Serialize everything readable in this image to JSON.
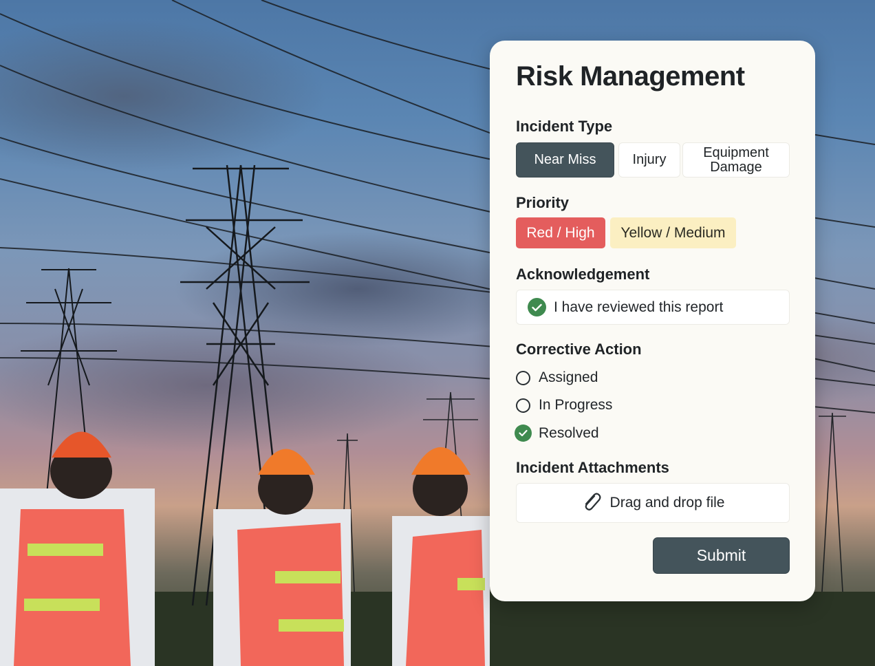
{
  "form": {
    "title": "Risk Management",
    "incident_type": {
      "label": "Incident Type",
      "options": [
        "Near Miss",
        "Injury",
        "Equipment Damage"
      ],
      "selected": "Near Miss"
    },
    "priority": {
      "label": "Priority",
      "options": [
        "Red / High",
        "Yellow / Medium"
      ],
      "selected": "Red / High",
      "colors": {
        "high": "#e45d5d",
        "medium": "#fbefc2"
      }
    },
    "acknowledgement": {
      "label": "Acknowledgement",
      "text": "I have reviewed this report",
      "checked": true
    },
    "corrective_action": {
      "label": "Corrective Action",
      "options": [
        "Assigned",
        "In Progress",
        "Resolved"
      ],
      "selected": "Resolved"
    },
    "attachments": {
      "label": "Incident Attachments",
      "dropzone_text": "Drag and drop file",
      "icon": "paperclip-icon"
    },
    "submit_label": "Submit",
    "accent_color": "#44545b",
    "check_color": "#3f8a4f"
  },
  "background": {
    "description_icon": "power-lines-workers-photo"
  }
}
